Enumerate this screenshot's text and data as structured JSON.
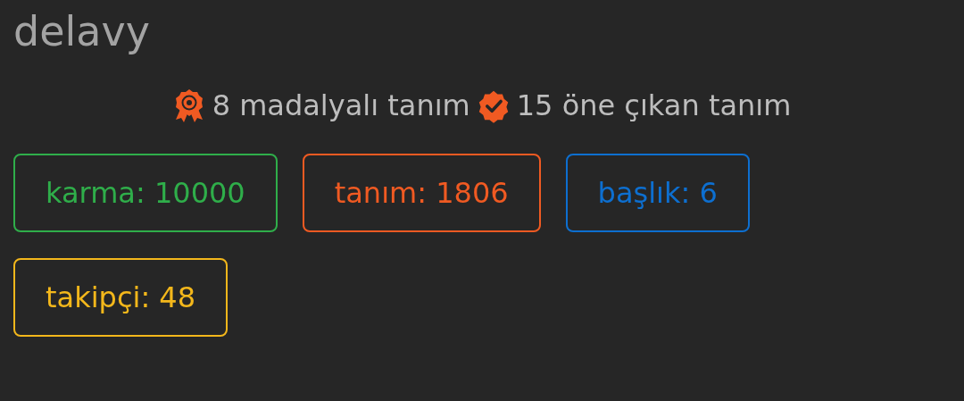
{
  "username": "delavy",
  "achievements": [
    {
      "kind": "medal",
      "text": "8 madalyalı tanım"
    },
    {
      "kind": "featured",
      "text": "15 öne çıkan tanım"
    }
  ],
  "stats": [
    {
      "label": "karma: 10000",
      "color": "#2fae4a"
    },
    {
      "label": "tanım: 1806",
      "color": "#f05a22"
    },
    {
      "label": "başlık: 6",
      "color": "#0d6fd0"
    },
    {
      "label": "takipçi: 48",
      "color": "#f3b71b"
    }
  ]
}
